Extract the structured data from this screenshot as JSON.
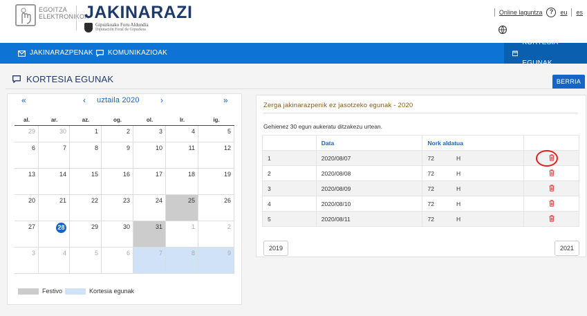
{
  "header": {
    "logo_text_1": "EGOITZA",
    "logo_text_2": "ELEKTRONIKOA",
    "brand": "JAKINARAZI",
    "brand_sub_1": "Gipuzkoako Foru Aldundia",
    "brand_sub_2": "Diputación Foral de Gipuzkoa",
    "online_help": "Online laguntza",
    "help_symbol": "?",
    "lang_eu": "eu",
    "lang_es": "es"
  },
  "nav": {
    "jakinarazpenak": "JAKINARAZPENAK",
    "komunikazioak": "KOMUNIKAZIOAK",
    "kortesia": "KORTESIA EGUNAK"
  },
  "section": {
    "title": "KORTESIA EGUNAK",
    "new_button": "BERRIA"
  },
  "calendar": {
    "prev_year": "«",
    "prev_month": "‹",
    "month_label": "uztaila 2020",
    "next_month": "›",
    "next_year": "»",
    "weekdays": [
      "al.",
      "ar.",
      "az.",
      "og.",
      "ol.",
      "lr.",
      "ig."
    ],
    "weeks": [
      [
        "29",
        "30",
        "1",
        "2",
        "3",
        "4",
        "5"
      ],
      [
        "6",
        "7",
        "8",
        "9",
        "10",
        "11",
        "12"
      ],
      [
        "13",
        "14",
        "15",
        "16",
        "17",
        "18",
        "19"
      ],
      [
        "20",
        "21",
        "22",
        "23",
        "24",
        "25",
        "26"
      ],
      [
        "27",
        "28",
        "29",
        "30",
        "31",
        "1",
        "2"
      ],
      [
        "3",
        "4",
        "5",
        "6",
        "7",
        "8",
        "9"
      ]
    ],
    "legend_festivo": "Festivo",
    "legend_kortesia": "Kortesia egunak",
    "colors": {
      "festivo": "#cccccc",
      "kortesia": "#cfe2f7",
      "today": "#1565c8"
    }
  },
  "list": {
    "title": "Zerga jakinarazpenik ez jasotzeko egunak - 2020",
    "note": "Gehienez 30 egun aukeratu ditzakezu urtean.",
    "columns": [
      "",
      "Data",
      "Nork aldatua",
      ""
    ],
    "rows": [
      {
        "n": "1",
        "date": "2020/08/07",
        "who_a": "72",
        "who_b": "H"
      },
      {
        "n": "2",
        "date": "2020/08/08",
        "who_a": "72",
        "who_b": "H"
      },
      {
        "n": "3",
        "date": "2020/08/09",
        "who_a": "72",
        "who_b": "H"
      },
      {
        "n": "4",
        "date": "2020/08/10",
        "who_a": "72",
        "who_b": "H"
      },
      {
        "n": "5",
        "date": "2020/08/11",
        "who_a": "72",
        "who_b": "H"
      }
    ],
    "prev_year": "2019",
    "next_year": "2021"
  }
}
